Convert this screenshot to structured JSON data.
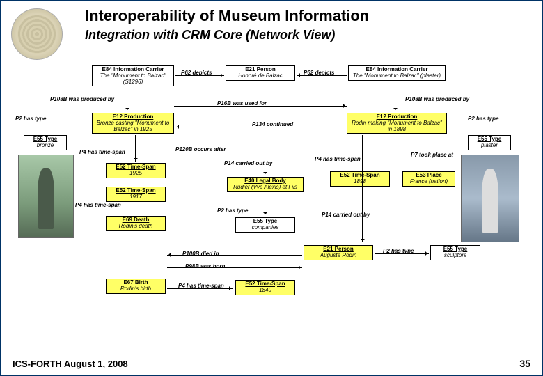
{
  "header": {
    "title": "Interoperability of Museum Information",
    "subtitle": "Integration with CRM Core (Network View)"
  },
  "footer": {
    "left": "ICS-FORTH  August 1, 2008",
    "right": "35"
  },
  "nodes": {
    "n1": {
      "cls": "E84 Information Carrier",
      "inst": "The \"Monument to Balzac\"(S1296)"
    },
    "n2": {
      "cls": "E21 Person",
      "inst": "Honoré de Balzac"
    },
    "n3": {
      "cls": "E84 Information Carrier",
      "inst": "The \"Monument to Balzac\" (plaster)"
    },
    "n4": {
      "cls": "E12 Production",
      "inst": "Bronze casting \"Monument to Balzac\" in 1925"
    },
    "n5": {
      "cls": "E12 Production",
      "inst": "Rodin making \"Monument to Balzac\" in 1898"
    },
    "n6": {
      "cls": "E55 Type",
      "inst": "bronze"
    },
    "n7": {
      "cls": "E55 Type",
      "inst": "plaster"
    },
    "n8": {
      "cls": "E52 Time-Span",
      "inst": "1925"
    },
    "n9": {
      "cls": "E52 Time-Span",
      "inst": "1917"
    },
    "n10": {
      "cls": "E40 Legal Body",
      "inst": "Rudier (Vve Alexis) et Fils"
    },
    "n11": {
      "cls": "E52 Time-Span",
      "inst": "1898"
    },
    "n12": {
      "cls": "E53 Place",
      "inst": "France (nation)"
    },
    "n13": {
      "cls": "E69 Death",
      "inst": "Rodin's death"
    },
    "n14": {
      "cls": "E55 Type",
      "inst": "companies"
    },
    "n15": {
      "cls": "E21 Person",
      "inst": "Auguste Rodin"
    },
    "n16": {
      "cls": "E55 Type",
      "inst": "sculptors"
    },
    "n17": {
      "cls": "E67 Birth",
      "inst": "Rodin's birth"
    },
    "n18": {
      "cls": "E52 Time-Span",
      "inst": "1840"
    }
  },
  "edges": {
    "e1": "P62 depicts",
    "e2": "P62 depicts",
    "e3": "P108B was produced by",
    "e4": "P16B was used for",
    "e5": "P108B was produced by",
    "e6": "P2 has type",
    "e7": "P134 continued",
    "e8": "P2 has type",
    "e9": "P4 has time-span",
    "e10": "P120B occurs after",
    "e11": "P14 carried out by",
    "e12": "P4 has time-span",
    "e13": "P7 took place at",
    "e14": "P4 has time-span",
    "e15": "P2 has type",
    "e16": "P14 carried out by",
    "e17": "P100B died in",
    "e18": "P2 has type",
    "e19": "P98B was born",
    "e20": "P4 has time-span"
  }
}
